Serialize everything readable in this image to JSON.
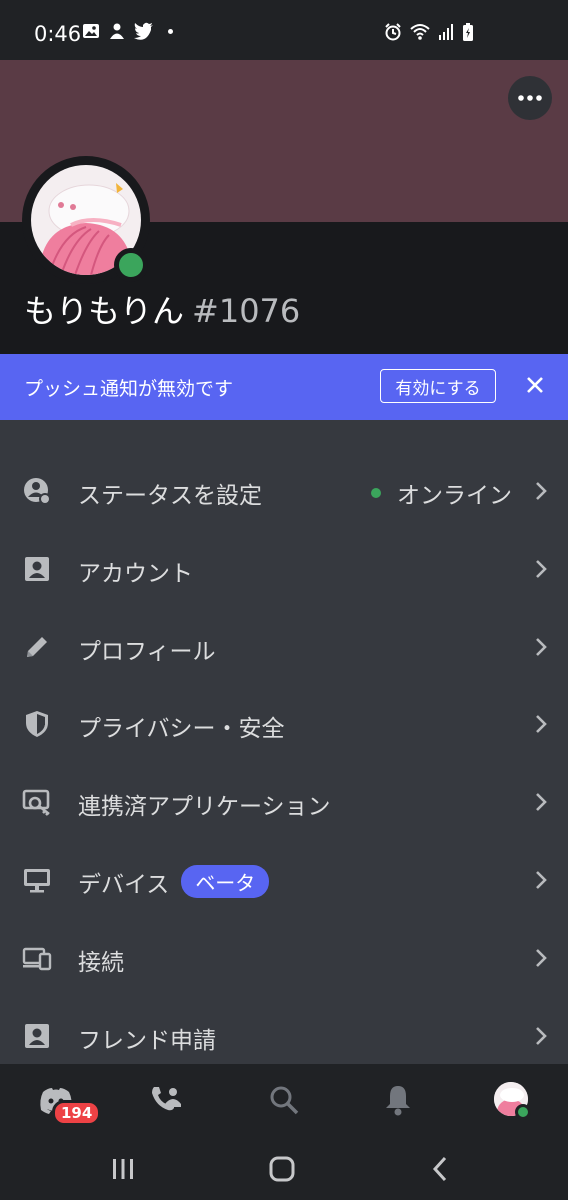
{
  "status_bar": {
    "time": "0:46"
  },
  "profile": {
    "name": "もりもりん",
    "discriminator": "#1076",
    "status_color": "#3ba55c",
    "banner_color": "#5a3b45"
  },
  "notice": {
    "text": "プッシュ通知が無効です",
    "enable_label": "有効にする"
  },
  "menu": [
    {
      "label": "ステータスを設定",
      "value": "オンライン",
      "icon": "status-icon"
    },
    {
      "label": "アカウント",
      "icon": "account-icon"
    },
    {
      "label": "プロフィール",
      "icon": "pencil-icon"
    },
    {
      "label": "プライバシー・安全",
      "icon": "shield-icon"
    },
    {
      "label": "連携済アプリケーション",
      "icon": "key-monitor-icon"
    },
    {
      "label": "デバイス",
      "badge": "ベータ",
      "icon": "monitor-icon"
    },
    {
      "label": "接続",
      "icon": "devices-icon"
    },
    {
      "label": "フレンド申請",
      "icon": "friend-request-icon"
    }
  ],
  "bottom_nav": {
    "home_badge": "194"
  },
  "colors": {
    "accent": "#5865f2",
    "background": "#36393f",
    "dark": "#202225"
  }
}
